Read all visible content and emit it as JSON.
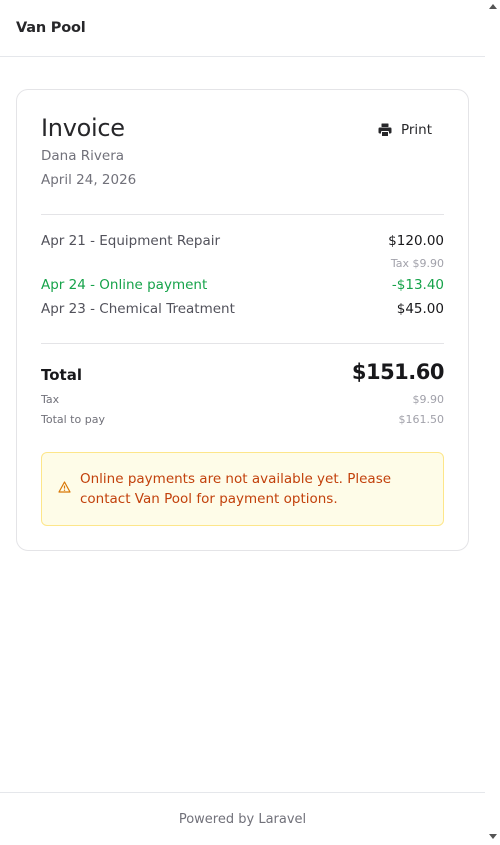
{
  "header": {
    "brand": "Van Pool"
  },
  "invoice": {
    "title": "Invoice",
    "print_label": "Print",
    "customer": "Dana Rivera",
    "date": "April 24, 2026"
  },
  "line_items": [
    {
      "label": "Apr 21 - Equipment Repair",
      "amount": "$120.00",
      "tax": "Tax $9.90"
    },
    {
      "label": "Apr 24 - Online payment",
      "amount": "-$13.40"
    },
    {
      "label": "Apr 23 - Chemical Treatment",
      "amount": "$45.00"
    }
  ],
  "totals": {
    "total_label": "Total",
    "total_value": "$151.60",
    "tax_label": "Tax",
    "tax_value": "$9.90",
    "pay_label": "Total to pay",
    "pay_value": "$161.50"
  },
  "notice": {
    "text": "Online payments are not available yet. Please contact Van Pool for payment options."
  },
  "footer": {
    "text": "Powered by Laravel"
  },
  "colors": {
    "payment_green": "#16a34a",
    "warning_text": "#c2410c",
    "warning_bg": "#fefce8"
  }
}
